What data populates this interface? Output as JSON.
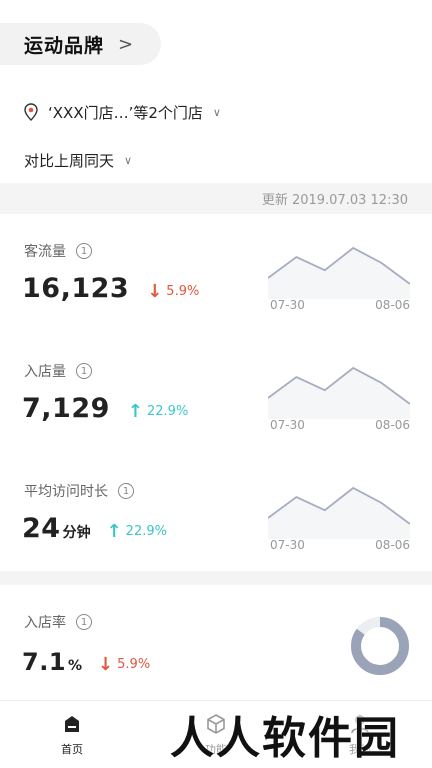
{
  "header": {
    "brand": "运动品牌",
    "brand_chevron": ">"
  },
  "filters": {
    "store": "‘XXX门店…’等2个门店",
    "compare": "对比上周同天",
    "chevron": "∨"
  },
  "update_text": "更新 2019.07.03 12:30",
  "metrics": [
    {
      "label": "客流量",
      "value": "16,123",
      "unit": "",
      "direction": "down",
      "arrow": "↓",
      "change": "5.9%",
      "date_start": "07-30",
      "date_end": "08-06",
      "spark": [
        35,
        70,
        48,
        85,
        60,
        25
      ]
    },
    {
      "label": "入店量",
      "value": "7,129",
      "unit": "",
      "direction": "up",
      "arrow": "↑",
      "change": "22.9%",
      "date_start": "07-30",
      "date_end": "08-06",
      "spark": [
        35,
        70,
        48,
        85,
        60,
        25
      ]
    },
    {
      "label": "平均访问时长",
      "value": "24",
      "unit": "分钟",
      "direction": "up",
      "arrow": "↑",
      "change": "22.9%",
      "date_start": "07-30",
      "date_end": "08-06",
      "spark": [
        35,
        70,
        48,
        85,
        60,
        25
      ]
    }
  ],
  "rate": {
    "label": "入店率",
    "value": "7.1",
    "unit": "%",
    "direction": "down",
    "arrow": "↓",
    "change": "5.9%",
    "donut_fraction": 0.85
  },
  "info_glyph": "1",
  "tabbar": [
    {
      "label": "首页",
      "icon": "home-icon",
      "active": true
    },
    {
      "label": "功能",
      "icon": "cube-icon",
      "active": false
    },
    {
      "label": "我的",
      "icon": "user-icon",
      "active": false
    }
  ],
  "watermark": "人人软件园",
  "colors": {
    "down": "#e0583f",
    "up": "#3cc6c8",
    "spark_line": "#a7acc1",
    "donut": "#9aa3b8"
  }
}
